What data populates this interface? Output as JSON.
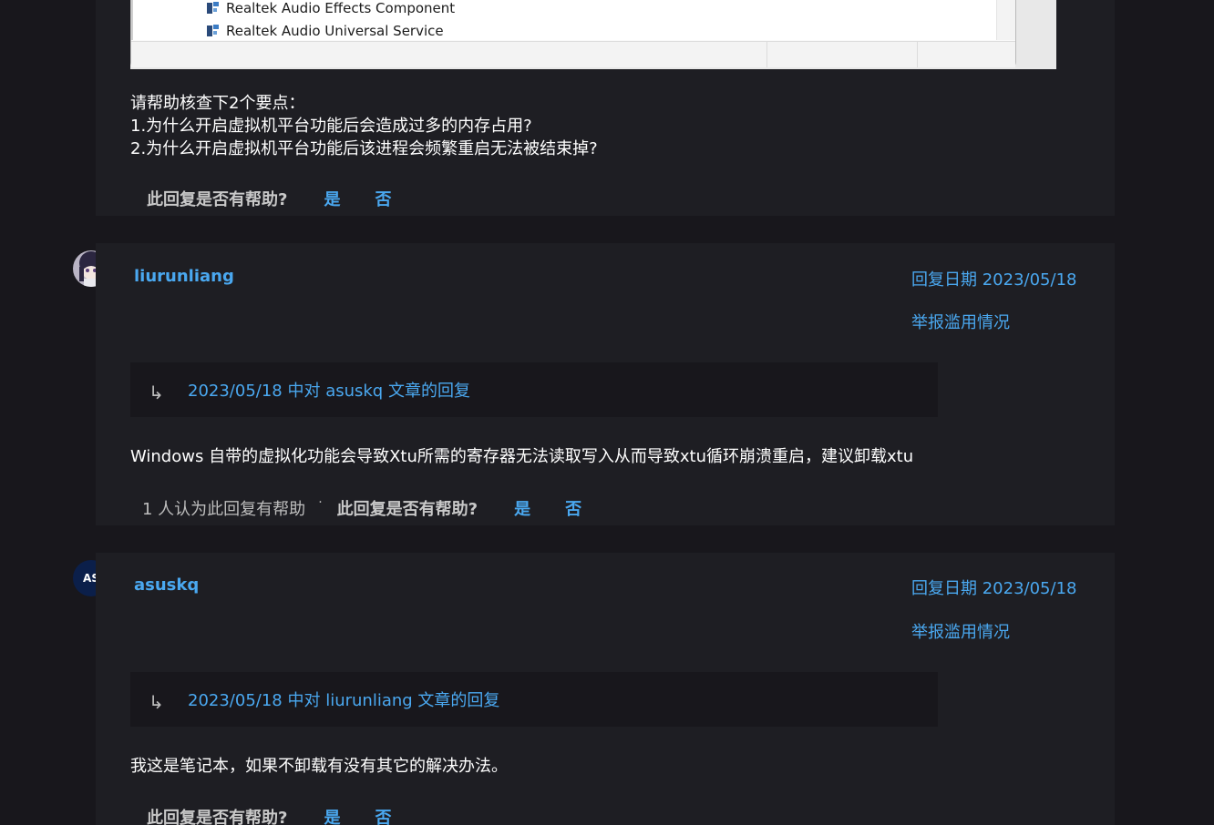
{
  "top_post": {
    "screenshot": {
      "processes": [
        "Realtek Audio Effects Component",
        "Realtek Audio Universal Service"
      ]
    },
    "lines": [
      "请帮助核查下2个要点：",
      "1.为什么开启虚拟机平台功能后会造成过多的内存占用?",
      "2.为什么开启虚拟机平台功能后该进程会频繁重启无法被结束掉?"
    ],
    "helpful": {
      "question": "此回复是否有帮助?",
      "yes": "是",
      "no": "否"
    }
  },
  "replies": [
    {
      "username": "liurunliang",
      "reply_date": "回复日期 2023/05/18",
      "report": "举报滥用情况",
      "reply_to": "2023/05/18 中对 asuskq 文章的回复",
      "body": "Windows 自带的虚拟化功能会导致Xtu所需的寄存器无法读取写入从而导致xtu循环崩溃重启，建议卸载xtu",
      "helpful_count": "1 人认为此回复有帮助",
      "helpful": {
        "question": "此回复是否有帮助?",
        "yes": "是",
        "no": "否"
      }
    },
    {
      "username": "asuskq",
      "avatar_initials": "AS",
      "reply_date": "回复日期 2023/05/18",
      "report": "举报滥用情况",
      "reply_to": "2023/05/18 中对 liurunliang 文章的回复",
      "body": "我这是笔记本，如果不卸载有没有其它的解决办法。",
      "helpful": {
        "question": "此回复是否有帮助?",
        "yes": "是",
        "no": "否"
      }
    }
  ],
  "colors": {
    "background": "#18171c",
    "card": "#1e1e23",
    "link": "#4aa8f0",
    "avatar_as": "#0b1f4a"
  }
}
